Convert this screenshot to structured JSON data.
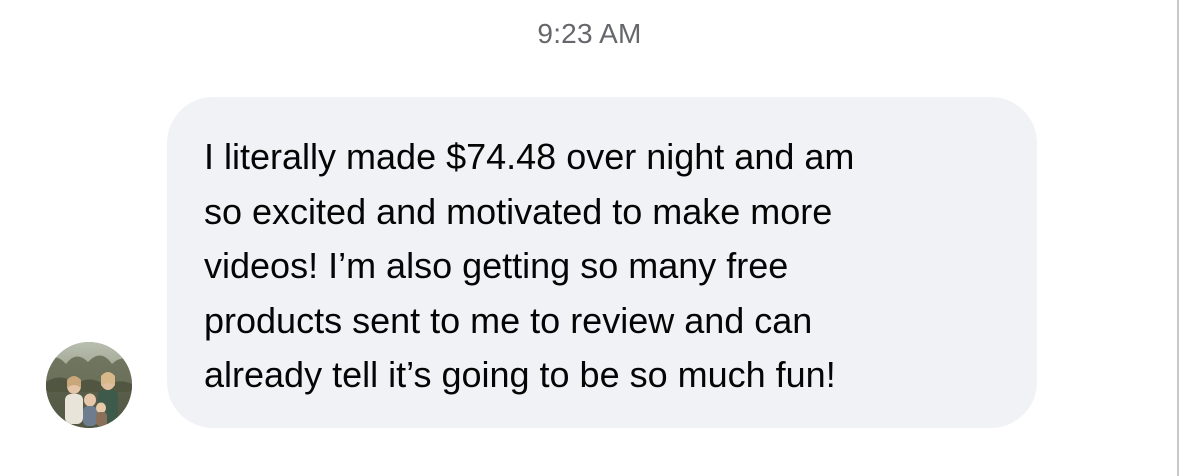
{
  "conversation": {
    "timestamp": "9:23 AM",
    "messages": [
      {
        "sender": "other",
        "avatar_icon": "user-profile-photo",
        "text": "I literally made $74.48 over night and am\nso excited and motivated to make more\nvideos! I’m also getting so many free\nproducts sent to me to review and can\nalready tell it’s going to be so much fun!"
      }
    ]
  },
  "colors": {
    "bubble_background": "#f0f2f5",
    "message_text": "#050505",
    "timestamp_text": "#65676b"
  }
}
